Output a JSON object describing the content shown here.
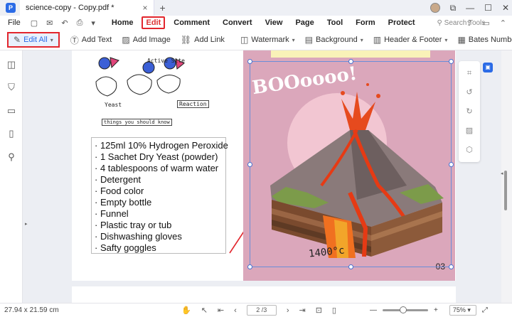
{
  "titlebar": {
    "tab_title": "science-copy - Copy.pdf *",
    "tab_close": "×",
    "new_tab": "+",
    "window_buttons": [
      "⧉",
      "—",
      "☐",
      "✕"
    ]
  },
  "menubar": {
    "file": "File",
    "items": [
      "Home",
      "Edit",
      "Comment",
      "Convert",
      "View",
      "Page",
      "Tool",
      "Form",
      "Protect"
    ],
    "active": "Edit",
    "search_tools": "Search Tools"
  },
  "toolbar": {
    "edit_all": "Edit All",
    "add_text": "Add Text",
    "add_image": "Add Image",
    "add_link": "Add Link",
    "watermark": "Watermark",
    "background": "Background",
    "header_footer": "Header & Footer",
    "bates_number": "Bates Number"
  },
  "page": {
    "sketch": {
      "active_site": "Active Site",
      "yeast": "Yeast",
      "reaction": "Reaction",
      "caption": "things you should know"
    },
    "list": [
      "· 125ml 10% Hydrogen Peroxide",
      "· 1 Sachet Dry Yeast (powder)",
      "· 4 tablespoons of warm water",
      "· Detergent",
      "· Food color",
      "· Empty bottle",
      "· Funnel",
      "· Plastic tray or tub",
      "· Dishwashing gloves",
      "· Safty goggles"
    ],
    "image": {
      "booom_text": "BOOoooo!",
      "temp_label": "1400°c",
      "page_number": "03"
    }
  },
  "statusbar": {
    "page_size": "27.94 x 21.59 cm",
    "page_indicator": "2 /3",
    "zoom": "75%"
  },
  "colors": {
    "accent": "#2b6be6",
    "highlight": "#e2262d",
    "panel_pink": "#dba7bb"
  }
}
